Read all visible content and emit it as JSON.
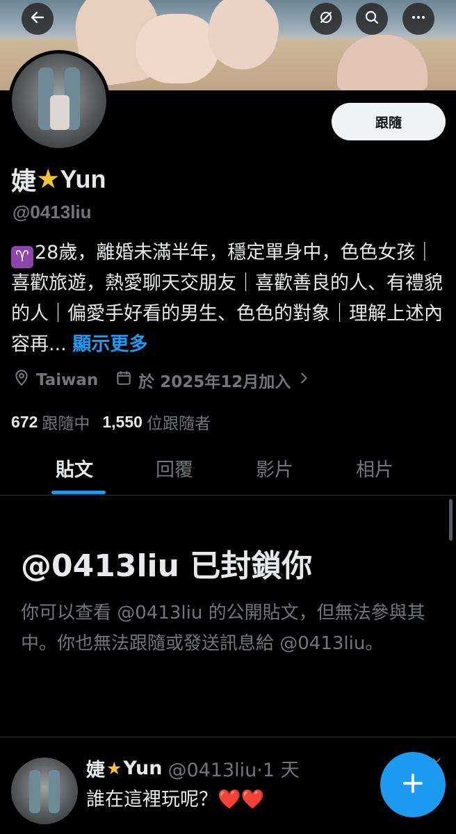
{
  "profile": {
    "name_prefix": "婕",
    "name_suffix": "Yun",
    "handle": "@0413liu",
    "follow_label": "跟隨",
    "bio_text": "28歲，離婚未滿半年，穩定單身中，色色女孩｜喜歡旅遊，熱愛聊天交朋友｜喜歡善良的人、有禮貌的人｜偏愛手好看的男生、色色的對象｜理解上述內容再...",
    "show_more": "顯示更多",
    "location": "Taiwan",
    "joined": "於 2025年12月加入",
    "following_count": "672",
    "following_label": "跟隨中",
    "followers_count": "1,550",
    "followers_label": "位跟隨者"
  },
  "tabs": [
    {
      "label": "貼文",
      "active": true
    },
    {
      "label": "回覆",
      "active": false
    },
    {
      "label": "影片",
      "active": false
    },
    {
      "label": "相片",
      "active": false
    }
  ],
  "blocked": {
    "title": "@0413liu 已封鎖你",
    "description": "你可以查看 @0413liu 的公開貼文，但無法參與其中。你也無法跟隨或發送訊息給 @0413liu。"
  },
  "post": {
    "name_prefix": "婕",
    "name_suffix": "Yun",
    "meta": "@0413liu·1 天",
    "text": "誰在這裡玩呢？",
    "hearts": "❤️❤️"
  },
  "icons": {
    "back": "arrow-left-icon",
    "hide": "circle-slash-icon",
    "search": "search-icon",
    "more": "more-dots-icon",
    "location": "location-pin-icon",
    "calendar": "calendar-icon",
    "compose": "plus-icon"
  },
  "colors": {
    "accent": "#1d9bf0",
    "background": "#000000",
    "muted": "#71767b",
    "aries": "#8e44ad",
    "star": "#f4c430"
  }
}
